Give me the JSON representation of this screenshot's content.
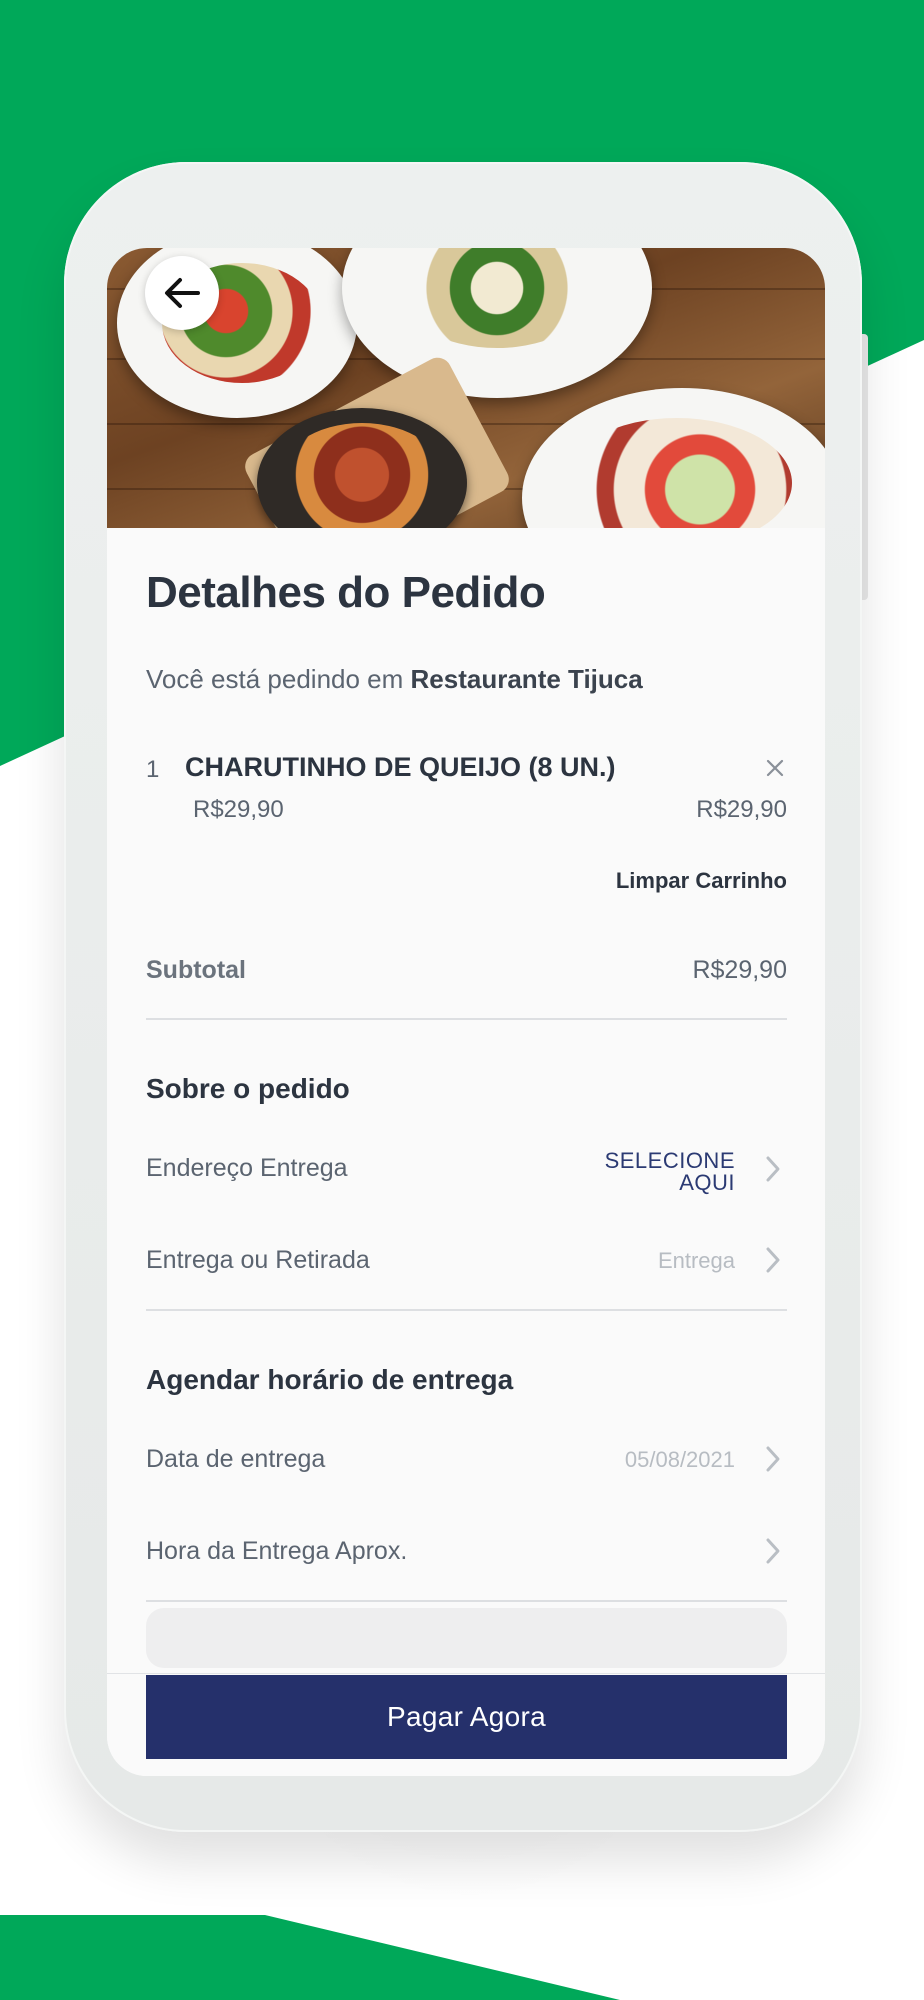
{
  "colors": {
    "brand_green": "#00a859",
    "primary_button": "#25306b",
    "title_text": "#2c3440",
    "link_text": "#2b3a73"
  },
  "icons": {
    "back": "arrow-left-icon",
    "remove_item": "close-icon",
    "row_chevron": "chevron-right-icon"
  },
  "header": {
    "title": "Detalhes do Pedido",
    "subtitle_prefix": "Você está pedindo em",
    "restaurant": "Restaurante Tijuca"
  },
  "cart": {
    "items": [
      {
        "qty": "1",
        "name": "CHARUTINHO DE QUEIJO (8 UN.)",
        "unit_price": "R$29,90",
        "total_price": "R$29,90"
      }
    ],
    "clear_label": "Limpar Carrinho",
    "subtotal_label": "Subtotal",
    "subtotal_value": "R$29,90"
  },
  "order_info": {
    "title": "Sobre o pedido",
    "address_label": "Endereço Entrega",
    "address_value_line1": "SELECIONE",
    "address_value_line2": "AQUI",
    "delivery_type_label": "Entrega ou Retirada",
    "delivery_type_value": "Entrega"
  },
  "schedule": {
    "title": "Agendar horário de entrega",
    "date_label": "Data de entrega",
    "date_value": "05/08/2021",
    "time_label": "Hora da Entrega Aprox.",
    "time_value": ""
  },
  "footer": {
    "pay_label": "Pagar Agora"
  }
}
